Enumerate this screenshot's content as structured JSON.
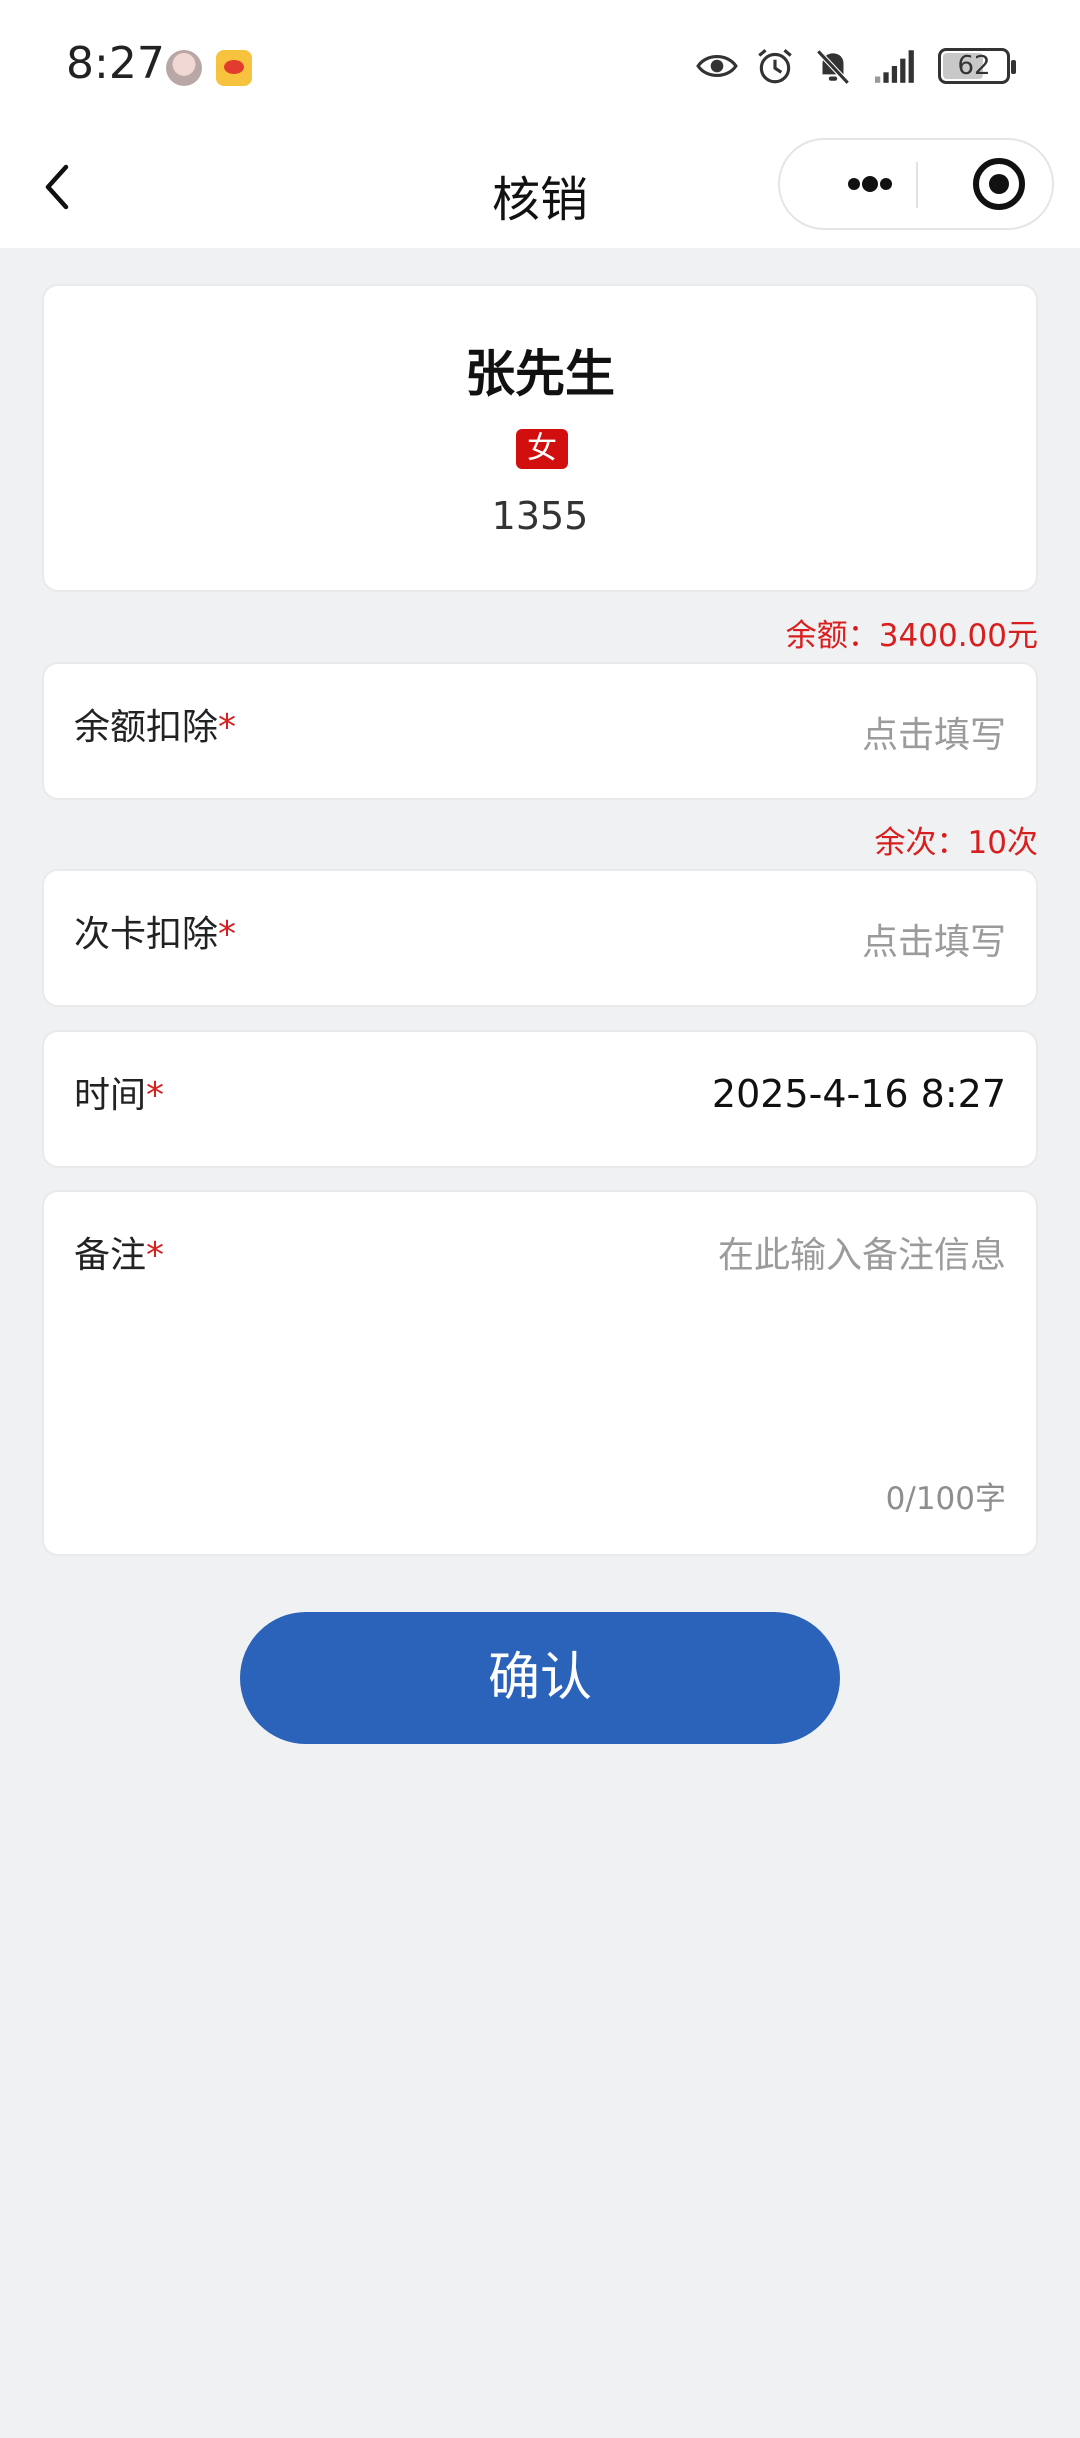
{
  "status_bar": {
    "time": "8:27",
    "battery": "62"
  },
  "nav": {
    "title": "核销"
  },
  "profile": {
    "name": "张先生",
    "gender": "女",
    "phone": "1355"
  },
  "balance_hint": "余额：3400.00元",
  "count_hint": "余次：10次",
  "fields": {
    "balance_deduct": {
      "label": "余额扣除",
      "required": "*",
      "placeholder": "点击填写"
    },
    "card_deduct": {
      "label": "次卡扣除",
      "required": "*",
      "placeholder": "点击填写"
    },
    "time": {
      "label": "时间",
      "required": "*",
      "value": "2025-4-16 8:27"
    },
    "remark": {
      "label": "备注",
      "required": "*",
      "placeholder": "在此输入备注信息",
      "counter": "0/100字"
    }
  },
  "confirm_label": "确认",
  "colors": {
    "accent": "#2b62ba",
    "required": "#d81e1e",
    "background": "#f0f1f3"
  }
}
